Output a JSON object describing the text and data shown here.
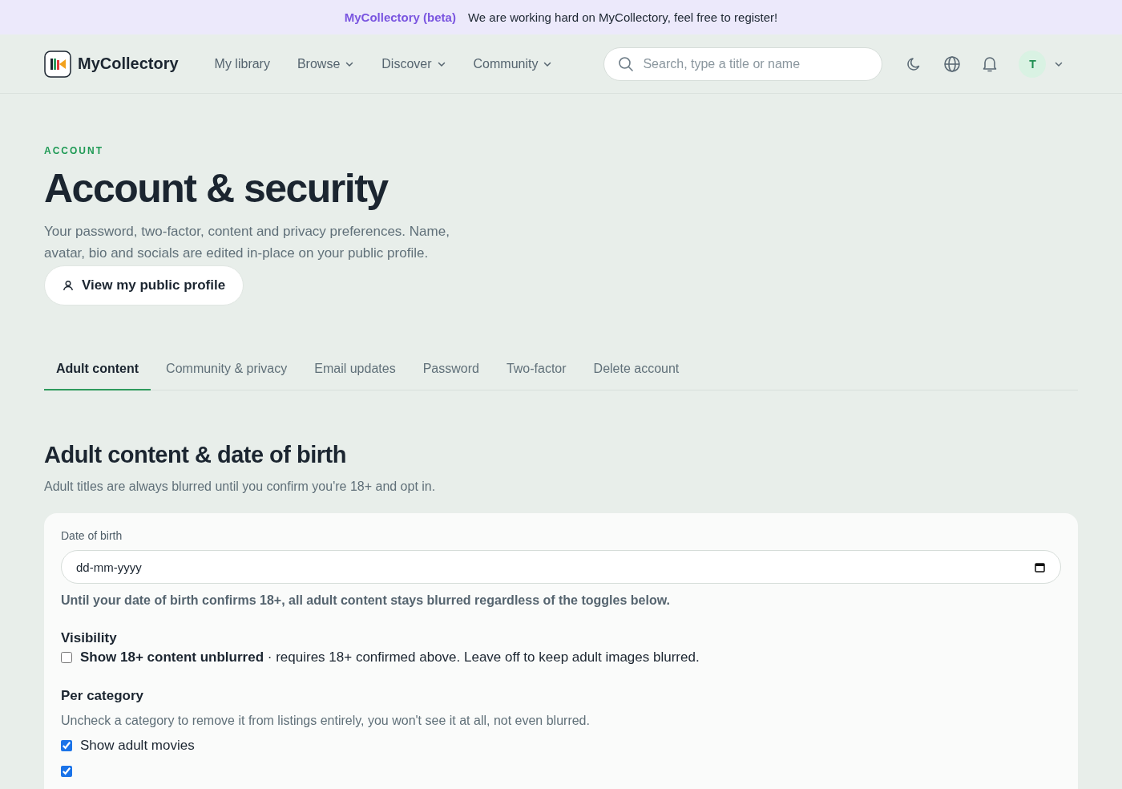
{
  "banner": {
    "brand": "MyCollectory (beta)",
    "message": "We are working hard on MyCollectory, feel free to register!"
  },
  "header": {
    "logo": "MyCollectory",
    "nav": [
      {
        "label": "My library",
        "dropdown": false
      },
      {
        "label": "Browse",
        "dropdown": true
      },
      {
        "label": "Discover",
        "dropdown": true
      },
      {
        "label": "Community",
        "dropdown": true
      }
    ],
    "search": {
      "placeholder": "Search, type a title or name"
    },
    "avatar": "T"
  },
  "page": {
    "eyebrow": "ACCOUNT",
    "title": "Account & security",
    "description": "Your password, two-factor, content and privacy preferences. Name, avatar, bio and socials are edited in-place on your public profile.",
    "profile_button": "View my public profile"
  },
  "tabs": [
    {
      "label": "Adult content",
      "selected": true
    },
    {
      "label": "Community & privacy",
      "selected": false
    },
    {
      "label": "Email updates",
      "selected": false
    },
    {
      "label": "Password",
      "selected": false
    },
    {
      "label": "Two-factor",
      "selected": false
    },
    {
      "label": "Delete account",
      "selected": false
    }
  ],
  "section": {
    "title": "Adult content & date of birth",
    "description": "Adult titles are always blurred until you confirm you're 18+ and opt in.",
    "dob": {
      "label": "Date of birth",
      "placeholder": "dd-mm-yyyy",
      "hint": "Until your date of birth confirms 18+, all adult content stays blurred regardless of the toggles below."
    },
    "visibility": {
      "heading": "Visibility",
      "checked": false,
      "label": "Show 18+ content unblurred",
      "note": "· requires 18+ confirmed above. Leave off to keep adult images blurred."
    },
    "per_category": {
      "heading": "Per category",
      "description": "Uncheck a category to remove it from listings entirely, you won't see it at all, not even blurred.",
      "items": [
        {
          "label": "Show adult movies",
          "checked": true
        },
        {
          "checked": true
        }
      ]
    }
  }
}
